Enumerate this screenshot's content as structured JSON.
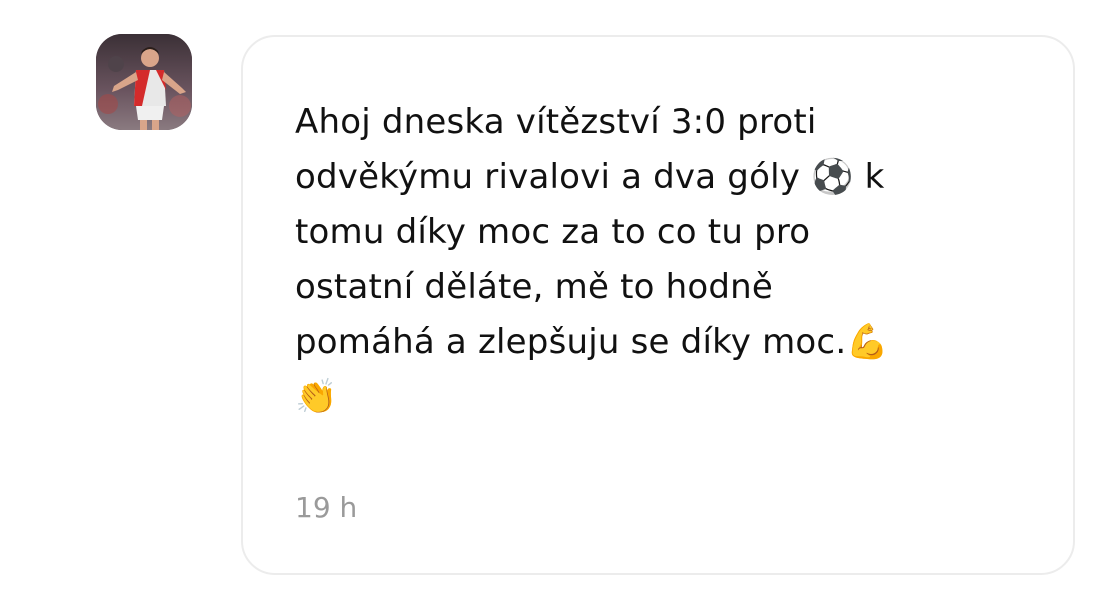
{
  "comment": {
    "avatar_icon": "user-avatar-footballer",
    "message": "Ahoj dneska vítězství 3:0 proti\nodvěkýmu rivalovi a dva góly ⚽ k\ntomu díky moc za to co tu pro\nostatní děláte, mě to hodně\npomáhá a zlepšuju se díky moc.💪\n👏",
    "timestamp": "19 h"
  },
  "colors": {
    "bubble_border": "#ececec",
    "text": "#111111",
    "timestamp": "#9a9a9a",
    "background": "#ffffff"
  }
}
